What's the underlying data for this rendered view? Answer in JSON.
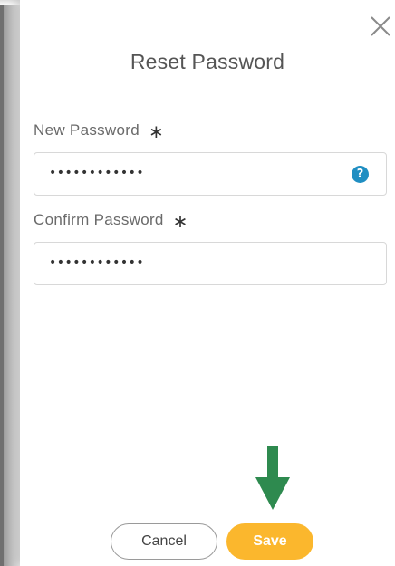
{
  "dialog": {
    "title": "Reset Password",
    "close_icon": "close-icon"
  },
  "fields": {
    "new_password": {
      "label": "New Password",
      "required_mark": "∗",
      "value": "••••••••••••",
      "help_icon": "question-circle-icon"
    },
    "confirm_password": {
      "label": "Confirm Password",
      "required_mark": "∗",
      "value": "••••••••••••"
    }
  },
  "actions": {
    "cancel_label": "Cancel",
    "save_label": "Save",
    "pointer_icon": "down-arrow-icon"
  },
  "colors": {
    "save_button": "#fbb72d",
    "help_icon": "#1f8ec2",
    "arrow": "#2e8a4f",
    "title_text": "#555555"
  }
}
